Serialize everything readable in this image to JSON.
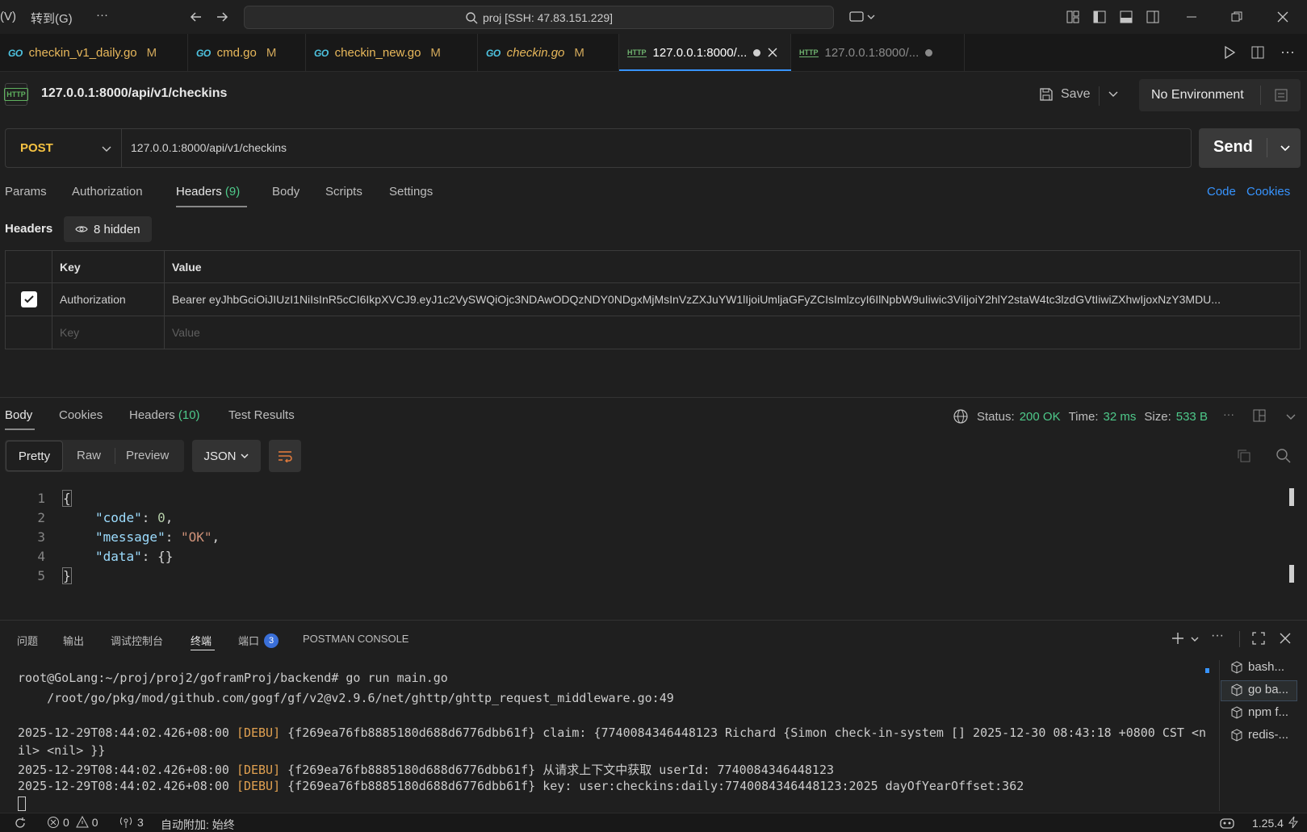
{
  "titlebar": {
    "menu_v": "(V)",
    "menu_goto": "转到(G)",
    "menu_more": "···",
    "search_text": "proj [SSH: 47.83.151.229]"
  },
  "tabs": [
    {
      "label": "checkin_v1_daily.go",
      "mod": "M",
      "type": "go"
    },
    {
      "label": "cmd.go",
      "mod": "M",
      "type": "go"
    },
    {
      "label": "checkin_new.go",
      "mod": "M",
      "type": "go"
    },
    {
      "label": "checkin.go",
      "mod": "M",
      "type": "go"
    },
    {
      "label": "127.0.0.1:8000/...",
      "type": "http"
    },
    {
      "label": "127.0.0.1:8000/...",
      "type": "http"
    }
  ],
  "request": {
    "title": "127.0.0.1:8000/api/v1/checkins",
    "save_label": "Save",
    "environment": "No Environment",
    "method": "POST",
    "url": "127.0.0.1:8000/api/v1/checkins",
    "send_label": "Send",
    "subtabs": {
      "params": "Params",
      "authorization": "Authorization",
      "headers": "Headers",
      "headers_count": "(9)",
      "body": "Body",
      "scripts": "Scripts",
      "settings": "Settings",
      "code": "Code",
      "cookies": "Cookies"
    },
    "headers_label": "Headers",
    "hidden_label": "8 hidden",
    "table": {
      "col_key": "Key",
      "col_value": "Value",
      "rows": [
        {
          "key": "Authorization",
          "value": "Bearer eyJhbGciOiJIUzI1NiIsInR5cCI6IkpXVCJ9.eyJ1c2VySWQiOjc3NDAwODQzNDY0NDgxMjMsInVzZXJuYW1lIjoiUmljaGFyZCIsImlzcyI6IlNpbW9uIiwic3ViIjoiY2hlY2staW4tc3lzdGVtIiwiZXhwIjoxNzY3MDU..."
        }
      ],
      "placeholder_key": "Key",
      "placeholder_value": "Value"
    }
  },
  "response": {
    "tabs": {
      "body": "Body",
      "cookies": "Cookies",
      "headers": "Headers",
      "headers_count": "(10)",
      "test_results": "Test Results"
    },
    "status_label": "Status:",
    "status_value": "200 OK",
    "time_label": "Time:",
    "time_value": "32 ms",
    "size_label": "Size:",
    "size_value": "533 B",
    "view_modes": {
      "pretty": "Pretty",
      "raw": "Raw",
      "preview": "Preview"
    },
    "format": "JSON",
    "lines": [
      "1",
      "2",
      "3",
      "4",
      "5"
    ],
    "json": {
      "open": "{",
      "code_key": "\"code\"",
      "code_val": "0",
      "message_key": "\"message\"",
      "message_val": "\"OK\"",
      "data_key": "\"data\"",
      "data_val": "{}",
      "close": "}"
    }
  },
  "panel": {
    "tabs": {
      "problems": "问题",
      "output": "输出",
      "debug_console": "调试控制台",
      "terminal": "终端",
      "ports": "端口",
      "ports_badge": "3",
      "postman_console": "POSTMAN CONSOLE"
    },
    "terminal": {
      "prompt_line": "root@GoLang:~/proj/proj2/goframProj/backend# go run main.go",
      "path_line": "    /root/go/pkg/mod/github.com/gogf/gf/v2@v2.9.6/net/ghttp/ghttp_request_middleware.go:49",
      "log1_ts": "2025-12-29T08:44:02.426+08:00",
      "log1_lvl": "[DEBU]",
      "log1_msg": "{f269ea76fb8885180d688d6776dbb61f} claim: {7740084346448123 Richard {Simon check-in-system [] 2025-12-30 08:43:18 +0800 CST <n",
      "log1_cont": "il> <nil> }}",
      "log2_ts": "2025-12-29T08:44:02.426+08:00",
      "log2_lvl": "[DEBU]",
      "log2_msg": "{f269ea76fb8885180d688d6776dbb61f} 从请求上下文中获取 userId: 7740084346448123",
      "log3_ts": "2025-12-29T08:44:02.426+08:00",
      "log3_lvl": "[DEBU]",
      "log3_msg": "{f269ea76fb8885180d688d6776dbb61f} key: user:checkins:daily:7740084346448123:2025 dayOfYearOffset:362"
    },
    "terminal_list": [
      "bash...",
      "go ba...",
      "npm f...",
      "redis-..."
    ]
  },
  "statusbar": {
    "errors": "0",
    "warnings": "0",
    "ports": "3",
    "auto_attach": "自动附加: 始终",
    "version": "1.25.4"
  },
  "colors": {
    "accent_blue": "#3794ff",
    "status_green": "#4ec98a",
    "method_yellow": "#f5c242",
    "go_blue": "#4ec3e0"
  }
}
